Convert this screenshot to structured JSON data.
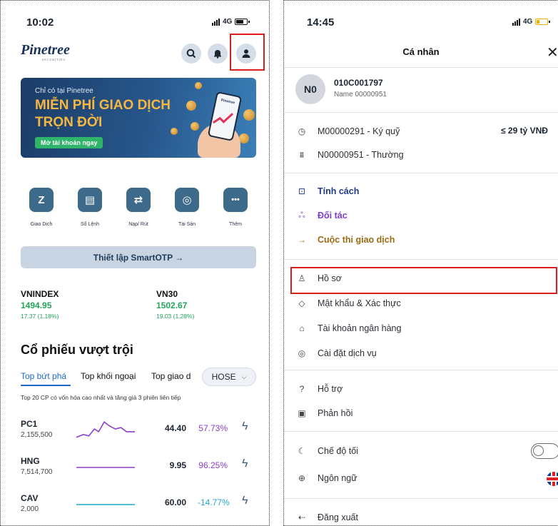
{
  "left": {
    "status": {
      "time": "10:02",
      "network": "4G",
      "battery_level": 0.75
    },
    "logo": {
      "text": "Pinetree",
      "sub": "SECURITIES"
    },
    "banner": {
      "line1": "Chỉ có tại Pinetree",
      "headline": "MIỄN PHÍ GIAO DỊCH TRỌN ĐỜI",
      "cta": "Mở tài khoản ngay",
      "phone_label": "Pinetree"
    },
    "actions": [
      {
        "label": "Giao Dịch",
        "icon": "z-icon",
        "glyph": "Z"
      },
      {
        "label": "Sổ Lệnh",
        "icon": "clipboard-icon",
        "glyph": "▤"
      },
      {
        "label": "Nạp/ Rút",
        "icon": "transfer-icon",
        "glyph": "⇄"
      },
      {
        "label": "Tài Sản",
        "icon": "asset-icon",
        "glyph": "◎"
      },
      {
        "label": "Thêm",
        "icon": "more-icon",
        "glyph": "•••"
      }
    ],
    "otp_button": "Thiết lập SmartOTP →",
    "indices": [
      {
        "name": "VNINDEX",
        "value": "1494.95",
        "change": "17.37 (1.18%)"
      },
      {
        "name": "VN30",
        "value": "1502.67",
        "change": "19.03 (1.28%)"
      }
    ],
    "section_title": "Cổ phiếu vượt trội",
    "tabs": [
      "Top bứt phá",
      "Top khối ngoại",
      "Top giao d"
    ],
    "exchange": "HOSE",
    "note": "Top 20 CP có vốn hóa cao nhất và tăng giá 3 phiên liên tiếp",
    "stocks": [
      {
        "symbol": "PC1",
        "volume": "2,155,500",
        "price": "44.40",
        "change": "57.73%",
        "spark_color": "#8b3fc9"
      },
      {
        "symbol": "HNG",
        "volume": "7,514,700",
        "price": "9.95",
        "change": "96.25%",
        "spark_color": "#8b3fc9"
      },
      {
        "symbol": "CAV",
        "volume": "2,000",
        "price": "60.00",
        "change": "-14.77%",
        "spark_color": "#1ea8c9"
      }
    ],
    "colors": {
      "up": "#22a55a",
      "purple": "#8b3fc9",
      "down": "#1ea8c9",
      "highlight": "#d9201c"
    }
  },
  "right": {
    "status": {
      "time": "14:45",
      "network": "4G",
      "battery_level": 0.3
    },
    "title": "Cá nhân",
    "profile": {
      "initials": "N0",
      "account": "010C001797",
      "name": "Name 00000951"
    },
    "accounts": [
      {
        "icon": "clock-icon",
        "glyph": "◷",
        "label": "M00000291 - Ký quỹ",
        "limit": "≤ 29 tỷ VNĐ"
      },
      {
        "icon": "chart-icon",
        "glyph": "⩩",
        "label": "N00000951 - Thường"
      }
    ],
    "features": [
      {
        "icon": "trend-icon",
        "glyph": "⊡",
        "label": "Tính cách",
        "color": "#1f3a8a"
      },
      {
        "icon": "partners-icon",
        "glyph": "ஃ",
        "label": "Đối tác",
        "color": "#7b3fc4"
      },
      {
        "icon": "arrow-right-icon",
        "glyph": "→",
        "label": "Cuộc thi giao dịch",
        "color": "#9a6b12"
      }
    ],
    "settings": [
      {
        "icon": "user-icon",
        "glyph": "♙",
        "label": "Hồ sơ"
      },
      {
        "icon": "shield-icon",
        "glyph": "◇",
        "label": "Mật khẩu & Xác thực"
      },
      {
        "icon": "bank-icon",
        "glyph": "⌂",
        "label": "Tài khoản ngân hàng"
      },
      {
        "icon": "settings-icon",
        "glyph": "◎",
        "label": "Cài đặt dịch vụ"
      }
    ],
    "support": [
      {
        "icon": "help-icon",
        "glyph": "?",
        "label": "Hỗ trợ"
      },
      {
        "icon": "feedback-icon",
        "glyph": "▣",
        "label": "Phản hồi"
      }
    ],
    "prefs": [
      {
        "icon": "moon-icon",
        "glyph": "☾",
        "label": "Chế độ tối"
      },
      {
        "icon": "globe-icon",
        "glyph": "⊕",
        "label": "Ngôn ngữ"
      }
    ],
    "dark_mode_on": false,
    "logout": {
      "icon": "logout-icon",
      "glyph": "⇠",
      "label": "Đăng xuất"
    }
  }
}
